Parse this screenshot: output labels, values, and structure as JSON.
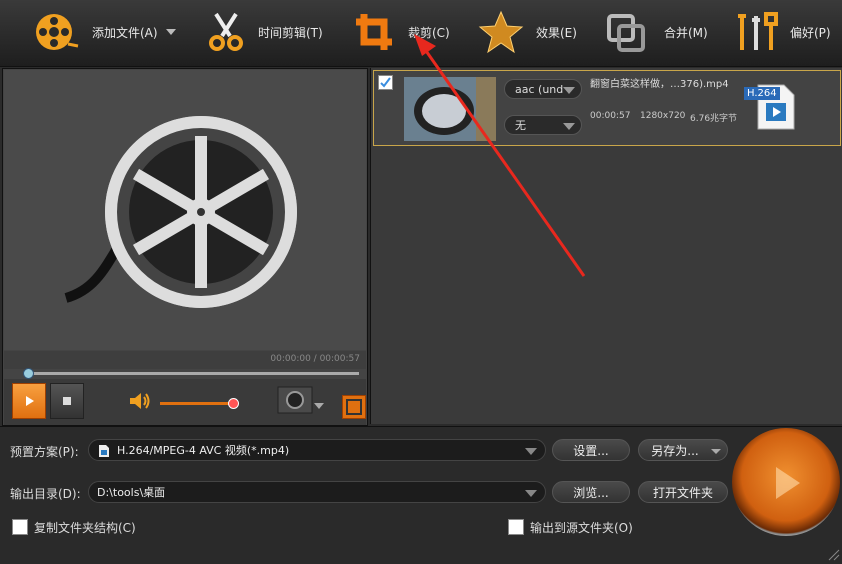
{
  "toolbar": {
    "add_file": "添加文件(A)",
    "trim": "时间剪辑(T)",
    "crop": "裁剪(C)",
    "effect": "效果(E)",
    "merge": "合并(M)",
    "preferences": "偏好(P)"
  },
  "preview": {
    "time": "00:00:00 / 00:00:57",
    "seek_progress": 0,
    "volume_level": 0.9
  },
  "file": {
    "checked": true,
    "name": "翻窗白菜这样做，…376).mp4",
    "audio_track": "aac (und",
    "subtitle": "无",
    "duration": "00:00:57",
    "resolution": "1280x720",
    "size": "6.76兆字节",
    "format_badge": "H.264"
  },
  "bottom": {
    "preset_label": "预置方案(P):",
    "preset_value": "H.264/MPEG-4 AVC 视频(*.mp4)",
    "settings_button": "设置...",
    "save_as_button": "另存为...",
    "output_label": "输出目录(D):",
    "output_value": "D:\\tools\\桌面",
    "browse_button": "浏览...",
    "open_folder_button": "打开文件夹",
    "copy_structure_label": "复制文件夹结构(C)",
    "output_to_source_label": "输出到源文件夹(O)"
  },
  "colors": {
    "accent": "#e07010",
    "annotation_arrow": "#e8281e"
  }
}
